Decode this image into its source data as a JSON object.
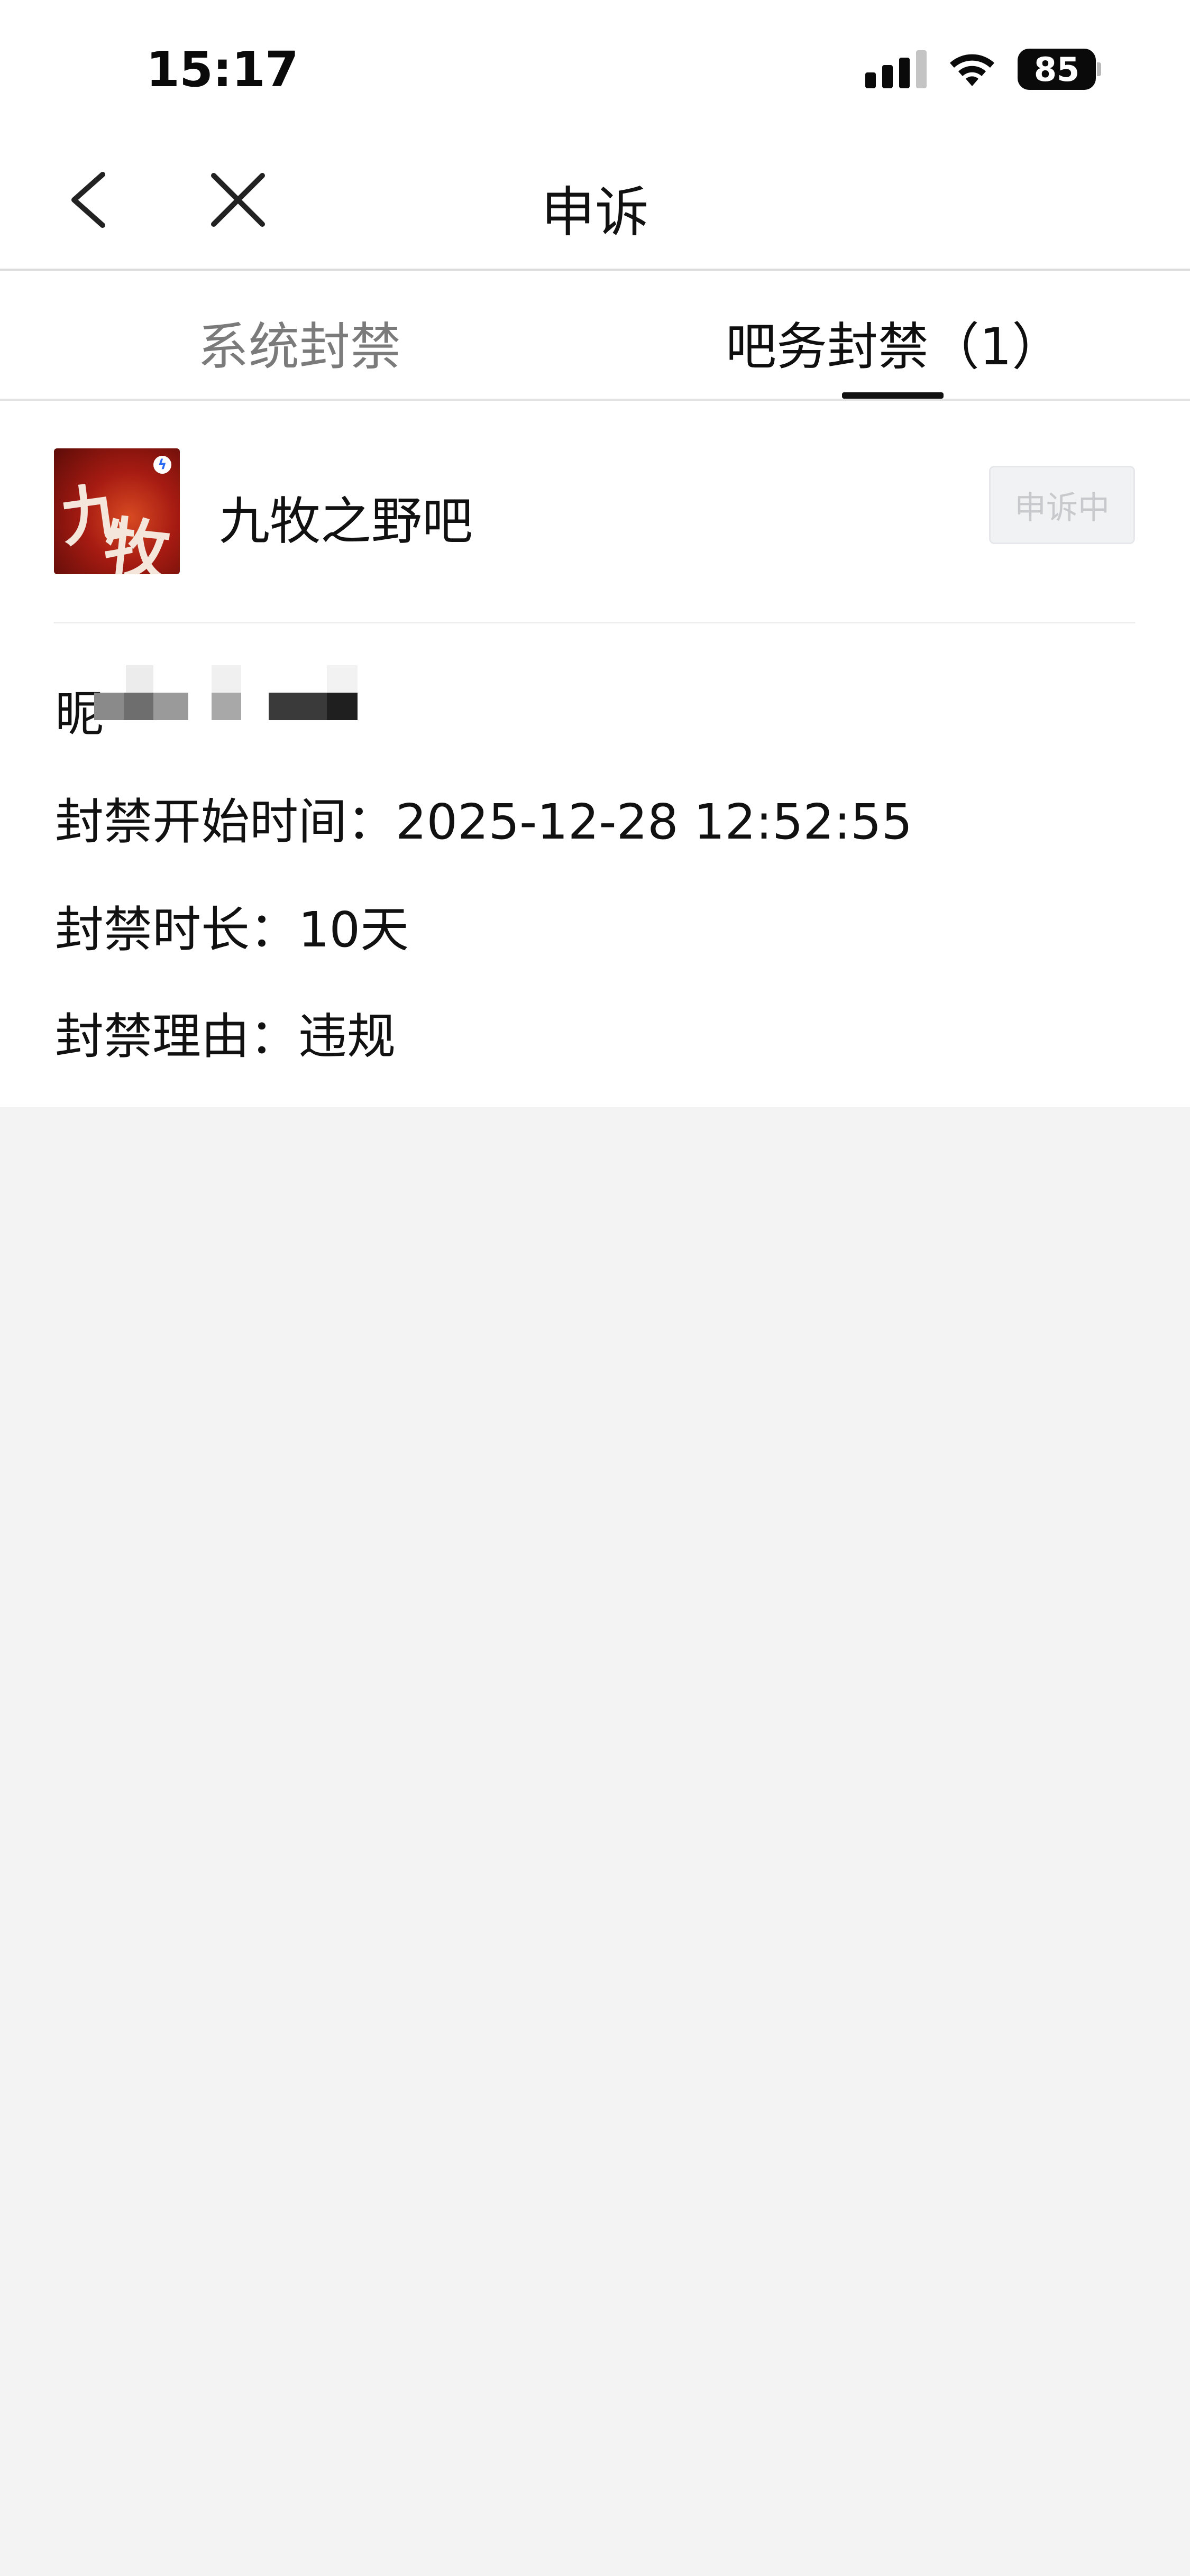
{
  "status_bar": {
    "time": "15:17",
    "battery_level": "85",
    "icons": [
      "cellular-signal-icon",
      "wifi-icon",
      "battery-icon"
    ]
  },
  "nav": {
    "title": "申诉",
    "back_icon": "chevron-left-icon",
    "close_icon": "close-icon"
  },
  "tabs": [
    {
      "label": "系统封禁",
      "active": false
    },
    {
      "label": "吧务封禁（1）",
      "active": true
    }
  ],
  "ban": {
    "forum_name": "九牧之野吧",
    "forum_avatar_text": "九牧",
    "status": "申诉中",
    "nickname_label": "昵",
    "start_time_line": "封禁开始时间：2025-12-28 12:52:55",
    "duration_line": "封禁时长：10天",
    "reason_line": "封禁理由：违规"
  },
  "colors": {
    "accent": "#111111",
    "inactive_tab": "#7b7b7b",
    "page_background": "#f3f3f4",
    "status_pill_bg": "#f1f2f4",
    "status_pill_text": "#c8c9cc"
  }
}
